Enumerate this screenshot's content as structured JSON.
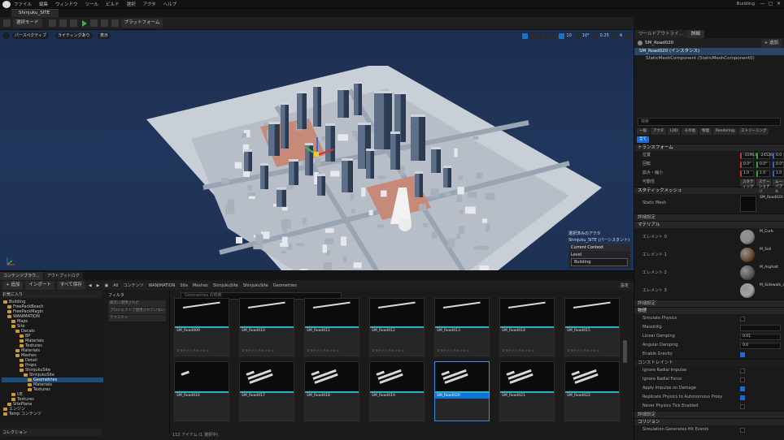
{
  "menu": {
    "items": [
      "ファイル",
      "編集",
      "ウィンドウ",
      "ツール",
      "ビルド",
      "選択",
      "アクタ",
      "ヘルプ"
    ],
    "project": "Building",
    "window_controls": [
      "—",
      "□",
      "✕"
    ]
  },
  "level_tab": {
    "label": "Shinjuku_SITE"
  },
  "toolbar": {
    "mode_label": "選択モード",
    "platform_label": "プラットフォーム"
  },
  "viewport": {
    "perspective": "パースペクティブ",
    "lighting": "ライティングあり",
    "show": "表示",
    "snap_grid": "10",
    "snap_rot": "10°",
    "snap_scale": "0.25",
    "cam_speed": "4",
    "selection": {
      "line1": "選択済みのアクタ",
      "line2": "Shinjuku_SITE (パーシスタント)",
      "current": "Current Context",
      "level_label": "Level",
      "level_value": "Building"
    }
  },
  "outliner": {
    "tab": "ワールドアウトライ...",
    "details_tab": "詳細",
    "add_label": "+ 追加"
  },
  "details": {
    "actor": "SM_Road020",
    "instance": "SM_Road020 (インスタンス)",
    "component": "StaticMeshComponent (StaticMeshComponent0)",
    "search_placeholder": "検索",
    "filters": [
      "一般",
      "アクタ",
      "LOD",
      "その他",
      "物理",
      "Rendering",
      "ストリーミング"
    ],
    "filter_all": "全て",
    "sections": {
      "transform": "トランスフォーム",
      "static_mesh": "スタティックメッシュ",
      "advanced": "詳細設定",
      "materials": "マテリアル",
      "physics": "物理",
      "collision": "コリジョン"
    },
    "location": {
      "label": "位置",
      "x": "-3196.0",
      "y": "-24526.",
      "z": "0.0"
    },
    "rotation": {
      "label": "回転",
      "x": "0.0°",
      "y": "0.0°",
      "z": "0.0°"
    },
    "scale": {
      "label": "拡大・縮小",
      "x": "1.0",
      "y": "1.0",
      "z": "1.0"
    },
    "mobility": {
      "label": "可動性",
      "options": [
        "スタティック",
        "ステーショナリ",
        "ムーバブル"
      ]
    },
    "mesh": {
      "label": "Static Mesh",
      "value": "SM_Road020"
    },
    "materials": [
      {
        "label": "エレメント 0",
        "name": "M_Curb",
        "color": "#8a8a8a"
      },
      {
        "label": "エレメント 1",
        "name": "M_Soil",
        "color": "#6b4a34"
      },
      {
        "label": "エレメント 2",
        "name": "M_Asphalt",
        "color": "#5a5a5a"
      },
      {
        "label": "エレメント 3",
        "name": "M_Sidewalk_a...",
        "color": "#a3a3a3"
      }
    ],
    "physics_rows": [
      {
        "label": "Simulate Physics",
        "type": "check",
        "on": false
      },
      {
        "label": "MassInKg",
        "type": "value",
        "value": ""
      },
      {
        "label": "Linear Damping",
        "type": "value",
        "value": "0.01"
      },
      {
        "label": "Angular Damping",
        "type": "value",
        "value": "0.0"
      },
      {
        "label": "Enable Gravity",
        "type": "check",
        "on": true
      }
    ],
    "constraints": "コンストレイント",
    "physics_rows2": [
      {
        "label": "Ignore Radial Impulse",
        "on": false
      },
      {
        "label": "Ignore Radial Force",
        "on": false
      },
      {
        "label": "Apply Impulse on Damage",
        "on": true
      },
      {
        "label": "Replicate Physics to Autonomous Proxy",
        "on": true
      },
      {
        "label": "Never Physics Tick Enabled",
        "on": false
      }
    ],
    "collision_row": "Simulation Generates Hit Events"
  },
  "content_browser": {
    "tabs": [
      "コンテンツブラウ...",
      "アウトプットログ"
    ],
    "add": "+ 追加",
    "import": "インポート",
    "save_all": "すべて保存",
    "breadcrumb": [
      "All",
      "コンテンツ",
      "WANIMATION",
      "Site",
      "Meshes",
      "ShinjukuSite",
      "ShinjukuSite",
      "Geometries"
    ],
    "settings": "設定",
    "favorites": "お気に入り",
    "search_placeholder": "Geometries の検索",
    "filter_label": "フィルタ",
    "filter_items": [
      "最近に使用された",
      "プロジェクトで使用されていない",
      "テクスチャ"
    ],
    "tree": [
      {
        "label": "Building",
        "depth": 0,
        "sel": false
      },
      {
        "label": "FreePackBeach",
        "depth": 1,
        "sel": false
      },
      {
        "label": "FreePackMagin",
        "depth": 1,
        "sel": false
      },
      {
        "label": "WANIMATION",
        "depth": 1,
        "sel": false
      },
      {
        "label": "Maps",
        "depth": 2,
        "sel": false
      },
      {
        "label": "Site",
        "depth": 2,
        "sel": false
      },
      {
        "label": "Decals",
        "depth": 3,
        "sel": false
      },
      {
        "label": "BP",
        "depth": 4,
        "sel": false
      },
      {
        "label": "Materials",
        "depth": 4,
        "sel": false
      },
      {
        "label": "Textures",
        "depth": 4,
        "sel": false
      },
      {
        "label": "Materials",
        "depth": 3,
        "sel": false
      },
      {
        "label": "Meshes",
        "depth": 3,
        "sel": false
      },
      {
        "label": "Detail",
        "depth": 4,
        "sel": false
      },
      {
        "label": "Props",
        "depth": 4,
        "sel": false
      },
      {
        "label": "ShinjukuSite",
        "depth": 4,
        "sel": false
      },
      {
        "label": "ShinjukuSite",
        "depth": 5,
        "sel": false
      },
      {
        "label": "Geometries",
        "depth": 6,
        "sel": true
      },
      {
        "label": "Materials",
        "depth": 6,
        "sel": false
      },
      {
        "label": "Textures",
        "depth": 6,
        "sel": false
      },
      {
        "label": "UE",
        "depth": 2,
        "sel": false
      },
      {
        "label": "Textures",
        "depth": 2,
        "sel": false
      },
      {
        "label": "SitePlane",
        "depth": 1,
        "sel": false
      },
      {
        "label": "エンジン",
        "depth": 0,
        "sel": false
      },
      {
        "label": "Temp コンテンツ",
        "depth": 0,
        "sel": false
      }
    ],
    "collections": "コレクション",
    "item_type": "スタティックメッシュ",
    "row1": [
      "SM_Road009",
      "SM_Road010",
      "SM_Road011",
      "SM_Road012",
      "SM_Road013",
      "SM_Road014",
      "SM_Road015"
    ],
    "row2": [
      "SM_Road016",
      "SM_Road017",
      "SM_Road018",
      "SM_Road019",
      "SM_Road020",
      "SM_Road021",
      "SM_Road022"
    ],
    "selected": "SM_Road020",
    "status": "112 アイテム (1 選択中)"
  }
}
